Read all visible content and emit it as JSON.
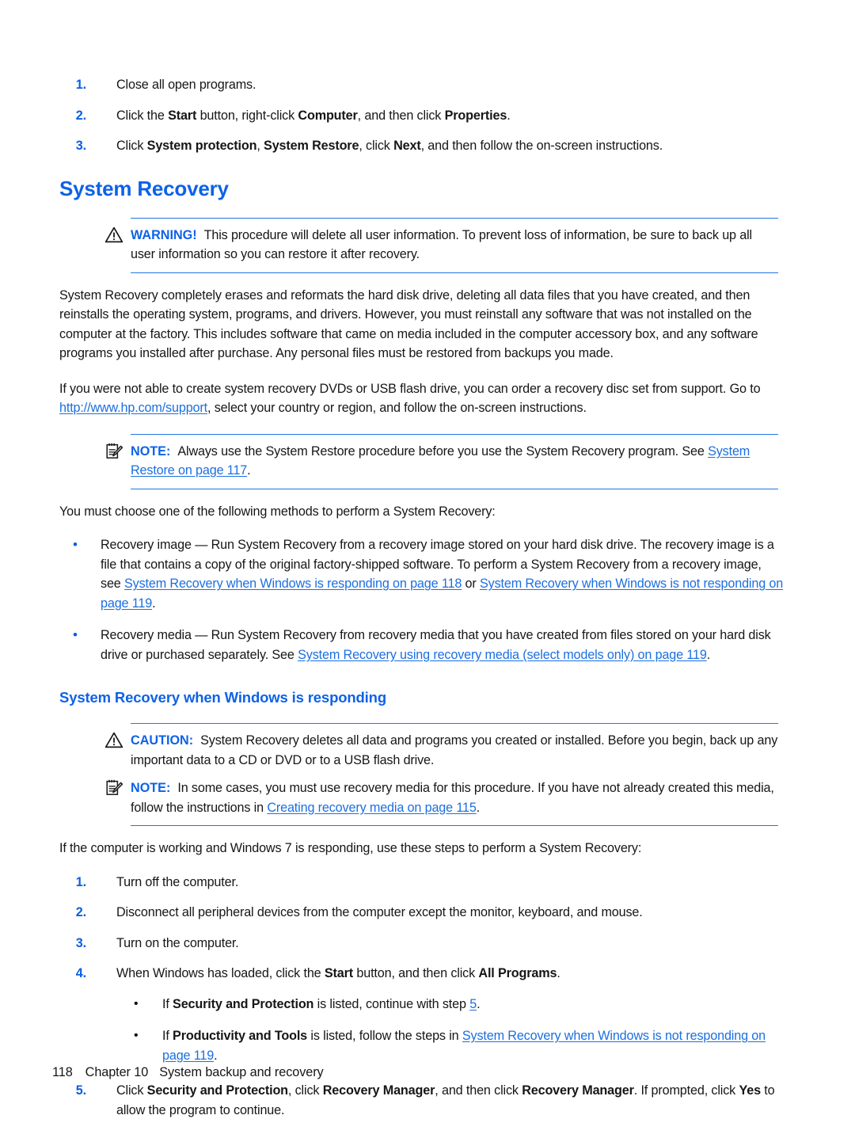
{
  "colors": {
    "heading_blue": "#0d62e8",
    "link_blue": "#1c6fe0",
    "rule_blue": "#2178e4",
    "body_black": "#161616"
  },
  "top_steps": [
    {
      "num": "1.",
      "parts": [
        {
          "t": "Close all open programs.",
          "style": "normal"
        }
      ]
    },
    {
      "num": "2.",
      "parts": [
        {
          "t": "Click the ",
          "style": "normal"
        },
        {
          "t": "Start",
          "style": "bold"
        },
        {
          "t": " button, right-click ",
          "style": "normal"
        },
        {
          "t": "Computer",
          "style": "bold"
        },
        {
          "t": ", and then click ",
          "style": "normal"
        },
        {
          "t": "Properties",
          "style": "bold"
        },
        {
          "t": ".",
          "style": "normal"
        }
      ]
    },
    {
      "num": "3.",
      "parts": [
        {
          "t": "Click ",
          "style": "normal"
        },
        {
          "t": "System protection",
          "style": "bold"
        },
        {
          "t": ", ",
          "style": "normal"
        },
        {
          "t": "System Restore",
          "style": "bold"
        },
        {
          "t": ", click ",
          "style": "normal"
        },
        {
          "t": "Next",
          "style": "bold"
        },
        {
          "t": ", and then follow the on-screen instructions.",
          "style": "normal"
        }
      ]
    }
  ],
  "section_heading": "System Recovery",
  "warning_box": {
    "icon": "warning-triangle-icon",
    "keyword": "WARNING!",
    "text": "This procedure will delete all user information. To prevent loss of information, be sure to back up all user information so you can restore it after recovery."
  },
  "paragraph_1": "System Recovery completely erases and reformats the hard disk drive, deleting all data files that you have created, and then reinstalls the operating system, programs, and drivers. However, you must reinstall any software that was not installed on the computer at the factory. This includes software that came on media included in the computer accessory box, and any software programs you installed after purchase. Any personal files must be restored from backups you made.",
  "paragraph_2": {
    "before_link": "If you were not able to create system recovery DVDs or USB flash drive, you can order a recovery disc set from support. Go to ",
    "link": "http://www.hp.com/support",
    "after_link": ", select your country or region, and follow the on-screen instructions."
  },
  "note_box_1": {
    "icon": "note-pad-pencil-icon",
    "keyword": "NOTE:",
    "before_link": "Always use the System Restore procedure before you use the System Recovery program. See ",
    "link": "System Restore on page 117",
    "after_link": "."
  },
  "paragraph_3": "You must choose one of the following methods to perform a System Recovery:",
  "method_bullets": [
    {
      "bullet": "•",
      "before_link": "Recovery image — Run System Recovery from a recovery image stored on your hard disk drive. The recovery image is a file that contains a copy of the original factory-shipped software. To perform a System Recovery from a recovery image, see ",
      "link1": "System Recovery when Windows is responding on page 118",
      "mid": " or ",
      "link2": "System Recovery when Windows is not responding on page 119",
      "after": "."
    },
    {
      "bullet": "•",
      "before_link": "Recovery media — Run System Recovery from recovery media that you have created from files stored on your hard disk drive or purchased separately. See ",
      "link1": "System Recovery using recovery media (select models only) on page 119",
      "mid": "",
      "link2": "",
      "after": "."
    }
  ],
  "subsection_heading": "System Recovery when Windows is responding",
  "caution_box": {
    "icon": "warning-triangle-icon",
    "keyword": "CAUTION:",
    "text": "System Recovery deletes all data and programs you created or installed. Before you begin, back up any important data to a CD or DVD or to a USB flash drive."
  },
  "note_box_2": {
    "icon": "note-pad-pencil-icon",
    "keyword": "NOTE:",
    "before_link": "In some cases, you must use recovery media for this procedure. If you have not already created this media, follow the instructions in ",
    "link": "Creating recovery media on page 115",
    "after_link": "."
  },
  "paragraph_4": "If the computer is working and Windows 7 is responding, use these steps to perform a System Recovery:",
  "procedure_steps": [
    {
      "num": "1.",
      "parts": [
        {
          "t": "Turn off the computer.",
          "style": "normal"
        }
      ]
    },
    {
      "num": "2.",
      "parts": [
        {
          "t": "Disconnect all peripheral devices from the computer except the monitor, keyboard, and mouse.",
          "style": "normal"
        }
      ]
    },
    {
      "num": "3.",
      "parts": [
        {
          "t": "Turn on the computer.",
          "style": "normal"
        }
      ]
    },
    {
      "num": "4.",
      "parts": [
        {
          "t": "When Windows has loaded, click the ",
          "style": "normal"
        },
        {
          "t": "Start",
          "style": "bold"
        },
        {
          "t": " button, and then click ",
          "style": "normal"
        },
        {
          "t": "All Programs",
          "style": "bold"
        },
        {
          "t": ".",
          "style": "normal"
        }
      ]
    },
    {
      "num": "5.",
      "parts": [
        {
          "t": "Click ",
          "style": "normal"
        },
        {
          "t": "Security and Protection",
          "style": "bold"
        },
        {
          "t": ", click ",
          "style": "normal"
        },
        {
          "t": "Recovery Manager",
          "style": "bold"
        },
        {
          "t": ", and then click ",
          "style": "normal"
        },
        {
          "t": "Recovery Manager",
          "style": "bold"
        },
        {
          "t": ". If prompted, click ",
          "style": "normal"
        },
        {
          "t": "Yes",
          "style": "bold"
        },
        {
          "t": " to allow the program to continue.",
          "style": "normal"
        }
      ]
    }
  ],
  "step4_sub_bullets": [
    {
      "bullet": "•",
      "parts": [
        {
          "t": "If ",
          "style": "normal"
        },
        {
          "t": "Security and Protection",
          "style": "bold"
        },
        {
          "t": " is listed, continue with step ",
          "style": "normal"
        },
        {
          "t": "5",
          "style": "link"
        },
        {
          "t": ".",
          "style": "normal"
        }
      ]
    },
    {
      "bullet": "•",
      "parts": [
        {
          "t": "If ",
          "style": "normal"
        },
        {
          "t": "Productivity and Tools",
          "style": "bold"
        },
        {
          "t": " is listed, follow the steps in ",
          "style": "normal"
        },
        {
          "t": "System Recovery when Windows is not responding on page 119",
          "style": "link"
        },
        {
          "t": ".",
          "style": "normal"
        }
      ]
    }
  ],
  "footer": {
    "page_number": "118",
    "chapter": "Chapter 10",
    "chapter_title": "System backup and recovery"
  }
}
